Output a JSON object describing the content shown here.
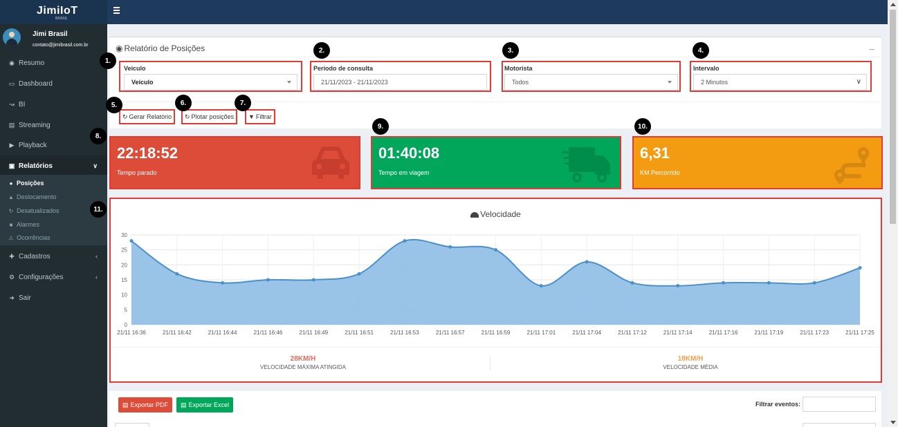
{
  "app": {
    "brand": "JimiIoT",
    "brand_sub": "BRASIL"
  },
  "user": {
    "name": "Jimi Brasil",
    "email": "contato@jimibrasil.com.br"
  },
  "sidebar": {
    "items": [
      {
        "label": "Resumo",
        "icon": "users-icon"
      },
      {
        "label": "Dashboard",
        "icon": "desktop-icon"
      },
      {
        "label": "BI",
        "icon": "chart-icon"
      },
      {
        "label": "Streaming",
        "icon": "streaming-icon"
      },
      {
        "label": "Playback",
        "icon": "play-icon"
      },
      {
        "label": "Relatórios",
        "icon": "file-icon"
      }
    ],
    "sub_items": [
      {
        "label": "Posições",
        "icon": "map-pin-icon"
      },
      {
        "label": "Deslocamento",
        "icon": "road-icon"
      },
      {
        "label": "Desatualizados",
        "icon": "refresh-icon"
      },
      {
        "label": "Alarmes",
        "icon": "video-icon"
      },
      {
        "label": "Ocorrências",
        "icon": "warning-icon"
      }
    ],
    "bottom_items": [
      {
        "label": "Cadastros",
        "icon": "plus-icon"
      },
      {
        "label": "Configurações",
        "icon": "gear-icon"
      },
      {
        "label": "Sair",
        "icon": "logout-icon"
      }
    ]
  },
  "report": {
    "title": "Relatório de Posições",
    "collapse": "–",
    "vehicle": {
      "label": "Veículo",
      "value": "Veículo"
    },
    "period": {
      "label": "Período de consulta",
      "value": "21/11/2023 - 21/11/2023"
    },
    "driver": {
      "label": "Motorista",
      "value": "Todos"
    },
    "interval": {
      "label": "Intervalo",
      "value": "2 Minutos"
    },
    "buttons": {
      "generate": "Gerar Relatório",
      "plot": "Plotar posições",
      "filter": "Filtrar"
    }
  },
  "markers": [
    "1.",
    "2.",
    "3.",
    "4.",
    "5.",
    "6.",
    "7.",
    "8.",
    "9.",
    "10.",
    "11."
  ],
  "kpis": [
    {
      "value": "22:18:52",
      "label": "Tempo parado",
      "color": "#dd4b39",
      "icon": "car-icon"
    },
    {
      "value": "01:40:08",
      "label": "Tempo em viagem",
      "color": "#00a65a",
      "icon": "truck-icon"
    },
    {
      "value": "6,31",
      "label": "KM Percorrido",
      "color": "#f39c12",
      "icon": "route-icon"
    }
  ],
  "chart_title": "Velocidade",
  "chart_data": {
    "type": "area",
    "title": "Velocidade",
    "x": [
      "21/11 16:36",
      "21/11 16:42",
      "21/11 16:44",
      "21/11 16:46",
      "21/11 16:49",
      "21/11 16:51",
      "21/11 16:53",
      "21/11 16:57",
      "21/11 16:59",
      "21/11 17:01",
      "21/11 17:04",
      "21/11 17:12",
      "21/11 17:14",
      "21/11 17:16",
      "21/11 17:19",
      "21/11 17:23",
      "21/11 17:25"
    ],
    "series": [
      {
        "values": [
          28,
          17,
          14,
          15,
          15,
          17,
          28,
          26,
          25,
          13,
          21,
          14,
          13,
          14,
          14,
          14,
          19
        ]
      }
    ],
    "ylim": [
      0,
      30
    ],
    "yticks": [
      0,
      5,
      10,
      15,
      20,
      25,
      30
    ],
    "grid": true,
    "colors": {
      "fill": "#8fbde6",
      "line": "#4a90c8"
    }
  },
  "stats": {
    "max": {
      "value": "28KM/H",
      "label": "VELOCIDADE MÁXIMA ATINGIDA",
      "color": "#e06a5a"
    },
    "avg": {
      "value": "18KM/H",
      "label": "VELOCIDADE MÉDIA",
      "color": "#f0a050"
    }
  },
  "export": {
    "pdf": "Exportar PDF",
    "excel": "Exportar Excel",
    "filter_events": "Filtrar eventos:"
  }
}
